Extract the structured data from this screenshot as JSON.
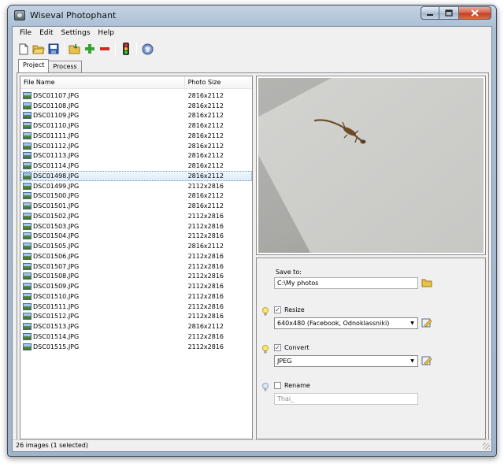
{
  "window": {
    "title": "Wiseval Photophant",
    "minimize_icon": "minimize-icon",
    "maximize_icon": "maximize-icon",
    "close_icon": "close-icon"
  },
  "menu": {
    "items": [
      "File",
      "Edit",
      "Settings",
      "Help"
    ]
  },
  "toolbar": {
    "buttons": [
      "new-icon",
      "open-folder-icon",
      "save-icon",
      "import-icon",
      "add-icon",
      "remove-icon",
      "traffic-light-icon",
      "about-icon"
    ]
  },
  "tabs": {
    "project": "Project",
    "process": "Process"
  },
  "filelist": {
    "columns": {
      "name": "File Name",
      "size": "Photo Size"
    },
    "rows": [
      {
        "name": "DSC01107.JPG",
        "size": "2816x2112"
      },
      {
        "name": "DSC01108.JPG",
        "size": "2816x2112"
      },
      {
        "name": "DSC01109.JPG",
        "size": "2816x2112"
      },
      {
        "name": "DSC01110.JPG",
        "size": "2816x2112"
      },
      {
        "name": "DSC01111.JPG",
        "size": "2816x2112"
      },
      {
        "name": "DSC01112.JPG",
        "size": "2816x2112"
      },
      {
        "name": "DSC01113.JPG",
        "size": "2816x2112"
      },
      {
        "name": "DSC01114.JPG",
        "size": "2816x2112"
      },
      {
        "name": "DSC01498.JPG",
        "size": "2816x2112",
        "selected": true
      },
      {
        "name": "DSC01499.JPG",
        "size": "2112x2816"
      },
      {
        "name": "DSC01500.JPG",
        "size": "2816x2112"
      },
      {
        "name": "DSC01501.JPG",
        "size": "2816x2112"
      },
      {
        "name": "DSC01502.JPG",
        "size": "2112x2816"
      },
      {
        "name": "DSC01503.JPG",
        "size": "2112x2816"
      },
      {
        "name": "DSC01504.JPG",
        "size": "2112x2816"
      },
      {
        "name": "DSC01505.JPG",
        "size": "2816x2112"
      },
      {
        "name": "DSC01506.JPG",
        "size": "2112x2816"
      },
      {
        "name": "DSC01507.JPG",
        "size": "2112x2816"
      },
      {
        "name": "DSC01508.JPG",
        "size": "2112x2816"
      },
      {
        "name": "DSC01509.JPG",
        "size": "2112x2816"
      },
      {
        "name": "DSC01510.JPG",
        "size": "2112x2816"
      },
      {
        "name": "DSC01511.JPG",
        "size": "2112x2816"
      },
      {
        "name": "DSC01512.JPG",
        "size": "2112x2816"
      },
      {
        "name": "DSC01513.JPG",
        "size": "2816x2112"
      },
      {
        "name": "DSC01514.JPG",
        "size": "2112x2816"
      },
      {
        "name": "DSC01515.JPG",
        "size": "2112x2816"
      }
    ]
  },
  "settings": {
    "save_to_label": "Save to:",
    "save_to_value": "C:\\My photos",
    "resize_label": "Resize",
    "resize_checked": true,
    "resize_value": "640x480 (Facebook, Odnoklassniki)",
    "convert_label": "Convert",
    "convert_checked": true,
    "convert_value": "JPEG",
    "rename_label": "Rename",
    "rename_checked": false,
    "rename_value": "Thai_"
  },
  "status": {
    "text": "26 images (1 selected)"
  }
}
